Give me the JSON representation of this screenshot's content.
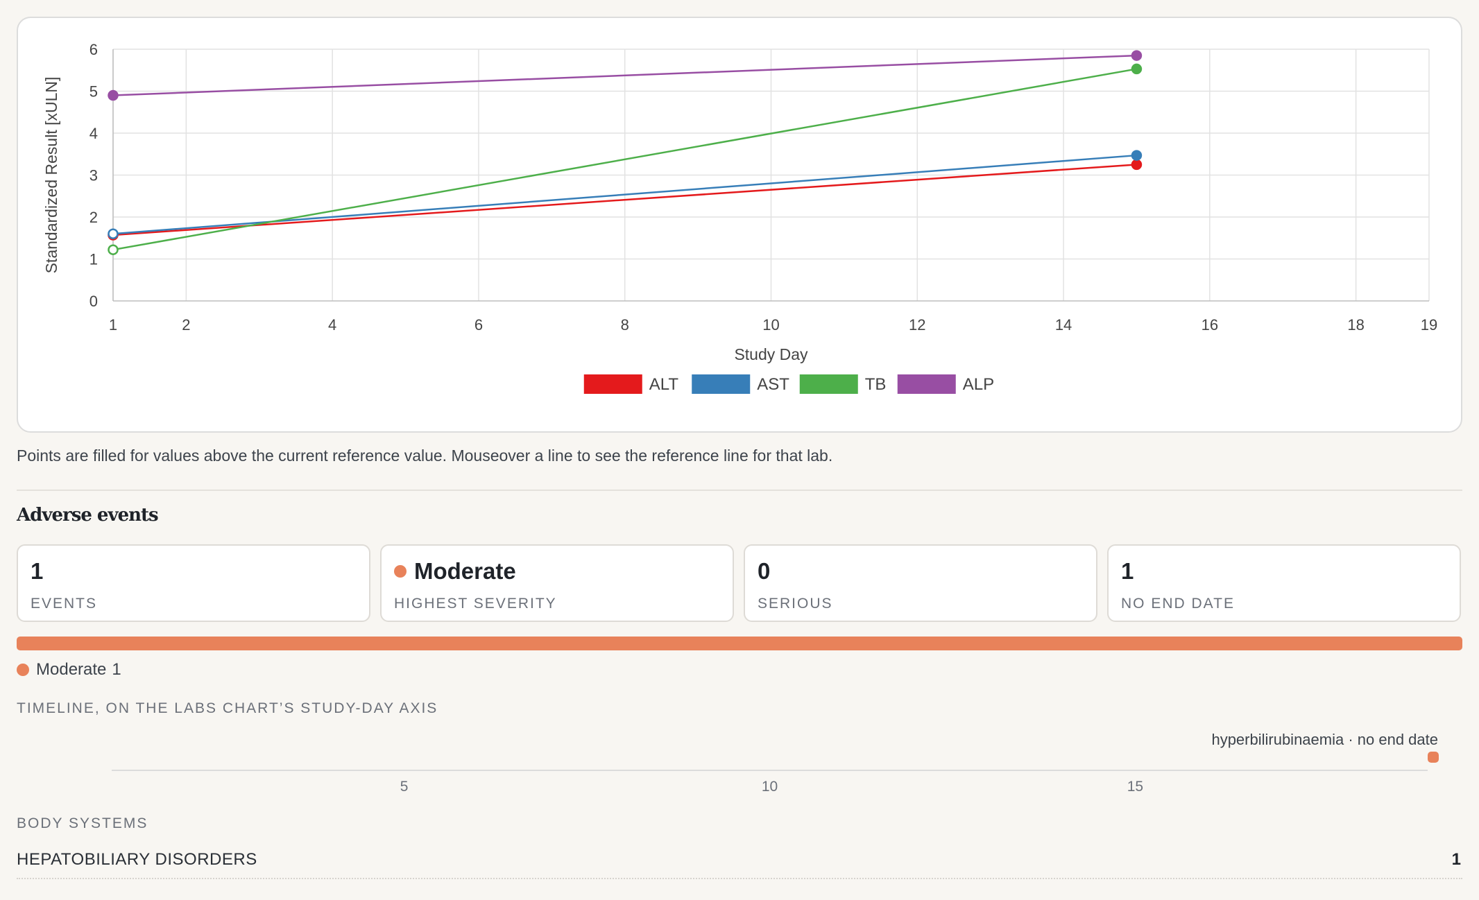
{
  "chart_data": {
    "type": "line",
    "title": "",
    "xlabel": "Study Day",
    "ylabel": "Standardized Result [xULN]",
    "xlim": [
      1,
      19
    ],
    "ylim": [
      0,
      6
    ],
    "x_ticks": [
      1,
      2,
      4,
      6,
      8,
      10,
      12,
      14,
      16,
      18,
      19
    ],
    "y_ticks": [
      0,
      1,
      2,
      3,
      4,
      5,
      6
    ],
    "grid": true,
    "legend_position": "bottom-center",
    "series": [
      {
        "name": "ALT",
        "color": "#e41a1c",
        "x": [
          1,
          15
        ],
        "y": [
          1.57,
          3.25
        ],
        "filled": [
          false,
          true
        ]
      },
      {
        "name": "AST",
        "color": "#377eb8",
        "x": [
          1,
          15
        ],
        "y": [
          1.6,
          3.47
        ],
        "filled": [
          false,
          true
        ]
      },
      {
        "name": "TB",
        "color": "#4daf4a",
        "x": [
          1,
          15
        ],
        "y": [
          1.22,
          5.53
        ],
        "filled": [
          false,
          true
        ]
      },
      {
        "name": "ALP",
        "color": "#984ea3",
        "x": [
          1,
          15
        ],
        "y": [
          4.9,
          5.85
        ],
        "filled": [
          true,
          true
        ]
      }
    ]
  },
  "chart_note": "Points are filled for values above the current reference value. Mouseover a line to see the reference line for that lab.",
  "adverse_events": {
    "title": "Adverse events",
    "stats": [
      {
        "value": "1",
        "label": "EVENTS"
      },
      {
        "value": "Moderate",
        "label": "HIGHEST SEVERITY",
        "dot_color": "#e8825a"
      },
      {
        "value": "0",
        "label": "SERIOUS"
      },
      {
        "value": "1",
        "label": "NO END DATE"
      }
    ],
    "severity_color": "#e8825a",
    "severity_legend": {
      "label": "Moderate",
      "count": "1"
    },
    "timeline": {
      "heading": "TIMELINE, ON THE LABS CHART’S STUDY-DAY AXIS",
      "axis_min": 1,
      "axis_max": 19,
      "ticks": [
        5,
        10,
        15
      ],
      "events": [
        {
          "label": "hyperbilirubinaemia · no end date",
          "start_day": 19,
          "ongoing": true
        }
      ]
    },
    "body_systems": {
      "heading": "BODY SYSTEMS",
      "items": [
        {
          "name": "HEPATOBILIARY DISORDERS",
          "count": "1"
        }
      ]
    }
  }
}
